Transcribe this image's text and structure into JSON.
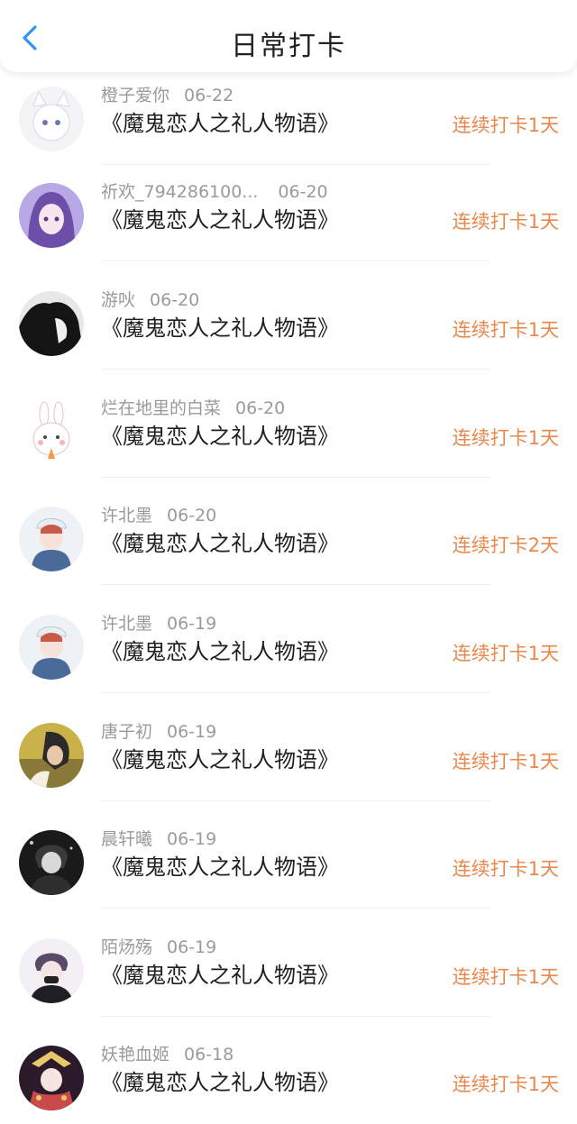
{
  "header": {
    "title": "日常打卡"
  },
  "entries": [
    {
      "user": "橙子爱你",
      "date": "06-22",
      "book": "《魔鬼恋人之礼人物语》",
      "streak": "连续打卡1天",
      "avatar": "white-cat-girl"
    },
    {
      "user": "祈欢_794286100...",
      "date": "06-20",
      "book": "《魔鬼恋人之礼人物语》",
      "streak": "连续打卡1天",
      "avatar": "purple-hair-girl"
    },
    {
      "user": "游吙",
      "date": "06-20",
      "book": "《魔鬼恋人之礼人物语》",
      "streak": "连续打卡1天",
      "avatar": "dark-silhouette"
    },
    {
      "user": "烂在地里的白菜",
      "date": "06-20",
      "book": "《魔鬼恋人之礼人物语》",
      "streak": "连续打卡1天",
      "avatar": "bunny"
    },
    {
      "user": "许北墨",
      "date": "06-20",
      "book": "《魔鬼恋人之礼人物语》",
      "streak": "连续打卡2天",
      "avatar": "boy-cap"
    },
    {
      "user": "许北墨",
      "date": "06-19",
      "book": "《魔鬼恋人之礼人物语》",
      "streak": "连续打卡1天",
      "avatar": "boy-cap"
    },
    {
      "user": "唐子初",
      "date": "06-19",
      "book": "《魔鬼恋人之礼人物语》",
      "streak": "连续打卡1天",
      "avatar": "golden-boy"
    },
    {
      "user": "晨轩曦",
      "date": "06-19",
      "book": "《魔鬼恋人之礼人物语》",
      "streak": "连续打卡1天",
      "avatar": "dark-boy"
    },
    {
      "user": "陌炀殇",
      "date": "06-19",
      "book": "《魔鬼恋人之礼人物语》",
      "streak": "连续打卡1天",
      "avatar": "mask-boy"
    },
    {
      "user": "妖艳血姬",
      "date": "06-18",
      "book": "《魔鬼恋人之礼人物语》",
      "streak": "连续打卡1天",
      "avatar": "ornate-girl"
    }
  ],
  "colors": {
    "streak": "#e8884e",
    "back_arrow": "#2f95f5",
    "muted": "#9a9a9a"
  }
}
